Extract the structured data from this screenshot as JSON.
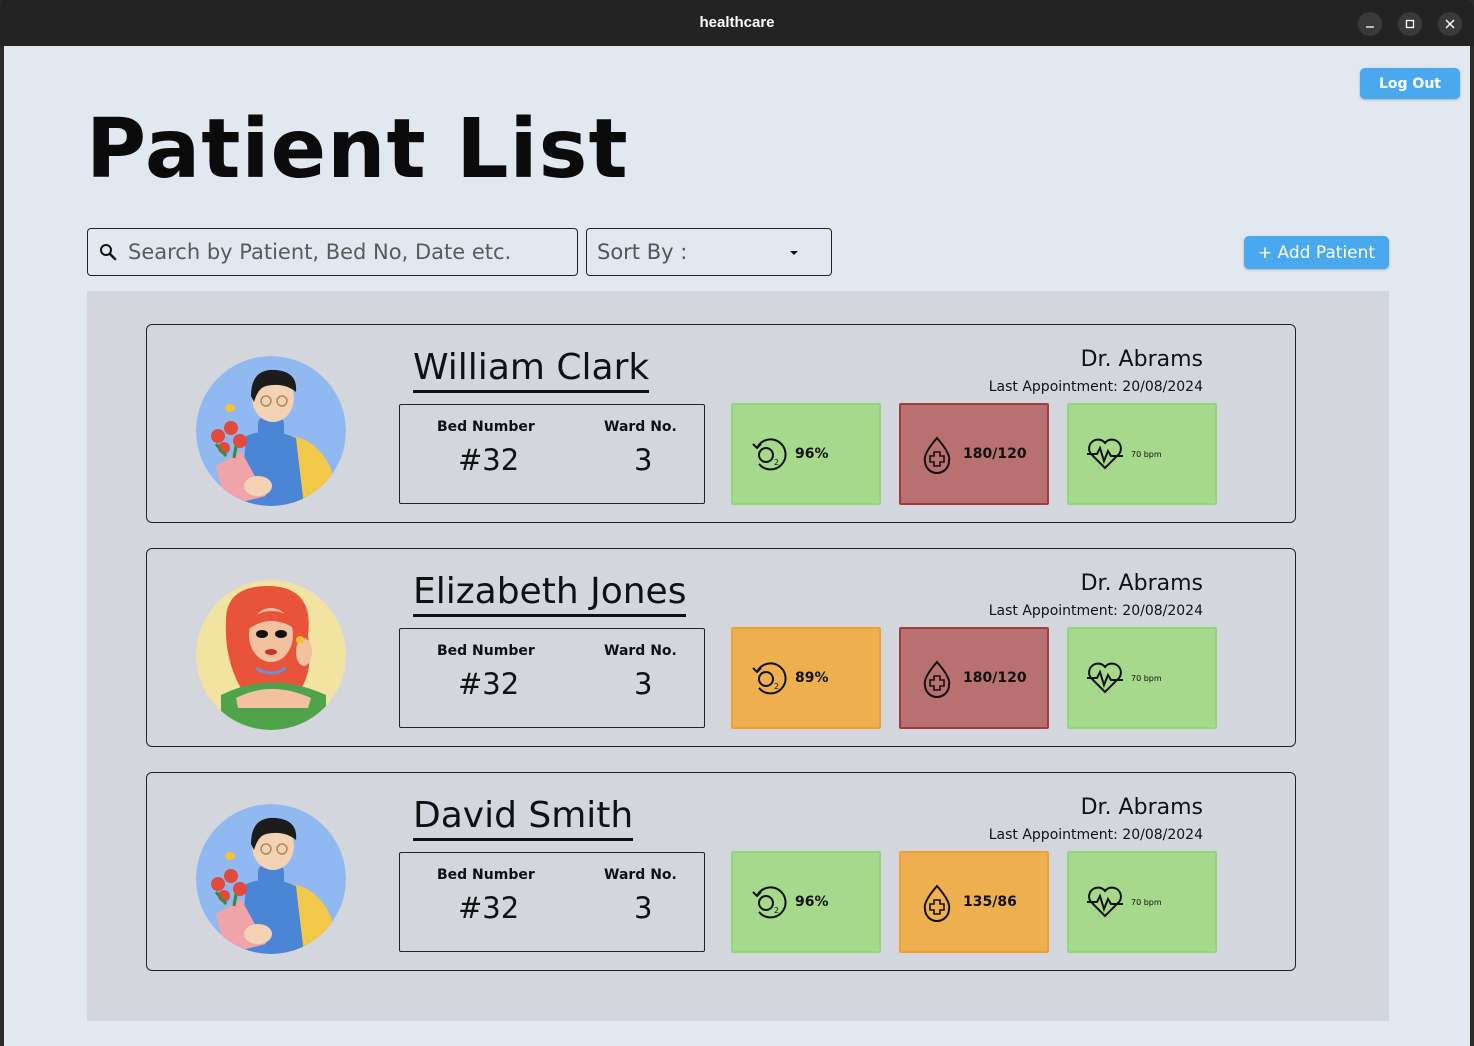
{
  "window": {
    "title": "healthcare"
  },
  "header": {
    "logout_label": "Log Out",
    "page_title": "Patient List"
  },
  "toolbar": {
    "search_placeholder": "Search by Patient, Bed No, Date etc.",
    "sort_label": "Sort By :",
    "add_patient_label": "+ Add Patient"
  },
  "colors": {
    "accent": "#4aa8ee",
    "ok": "#a6d98b",
    "danger": "#b87070",
    "warning": "#eeb04f"
  },
  "patients": [
    {
      "name": "William Clark",
      "doctor": "Dr. Abrams",
      "last_appointment": "Last Appointment: 20/08/2024",
      "bed_label": "Bed Number",
      "bed": "#32",
      "ward_label": "Ward No.",
      "ward": "3",
      "avatar_icon": "man-with-flowers-avatar",
      "oxygen": {
        "value": "96%",
        "status": "green"
      },
      "blood_pressure": {
        "value": "180/120",
        "status": "red"
      },
      "heart_rate": {
        "value": "70 bpm",
        "status": "green"
      }
    },
    {
      "name": "Elizabeth Jones",
      "doctor": "Dr. Abrams",
      "last_appointment": "Last Appointment: 20/08/2024",
      "bed_label": "Bed Number",
      "bed": "#32",
      "ward_label": "Ward No.",
      "ward": "3",
      "avatar_icon": "red-hair-woman-avatar",
      "oxygen": {
        "value": "89%",
        "status": "orange"
      },
      "blood_pressure": {
        "value": "180/120",
        "status": "red"
      },
      "heart_rate": {
        "value": "70 bpm",
        "status": "green"
      }
    },
    {
      "name": "David Smith",
      "doctor": "Dr. Abrams",
      "last_appointment": "Last Appointment: 20/08/2024",
      "bed_label": "Bed Number",
      "bed": "#32",
      "ward_label": "Ward No.",
      "ward": "3",
      "avatar_icon": "man-with-flowers-avatar",
      "oxygen": {
        "value": "96%",
        "status": "green"
      },
      "blood_pressure": {
        "value": "135/86",
        "status": "orange"
      },
      "heart_rate": {
        "value": "70 bpm",
        "status": "green"
      }
    }
  ]
}
